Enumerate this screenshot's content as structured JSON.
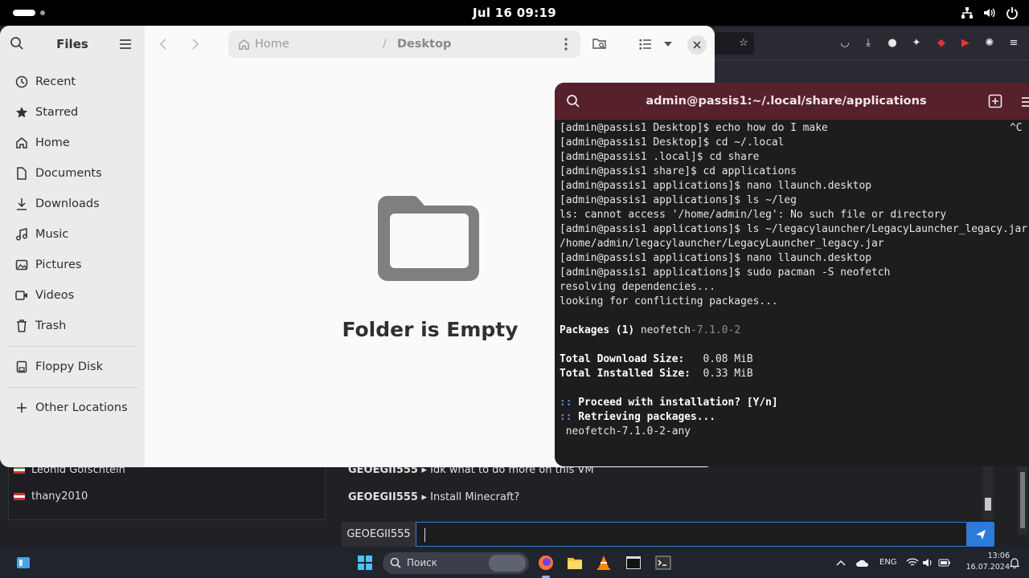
{
  "topbar": {
    "datetime": "Jul 16  09:19"
  },
  "files": {
    "sidebar_title": "Files",
    "places": [
      {
        "label": "Recent",
        "icon": "clock-icon"
      },
      {
        "label": "Starred",
        "icon": "star-icon"
      },
      {
        "label": "Home",
        "icon": "home-icon"
      },
      {
        "label": "Documents",
        "icon": "document-icon"
      },
      {
        "label": "Downloads",
        "icon": "download-icon"
      },
      {
        "label": "Music",
        "icon": "music-icon"
      },
      {
        "label": "Pictures",
        "icon": "picture-icon"
      },
      {
        "label": "Videos",
        "icon": "video-icon"
      },
      {
        "label": "Trash",
        "icon": "trash-icon"
      }
    ],
    "devices": [
      {
        "label": "Floppy Disk",
        "icon": "floppy-disk-icon"
      }
    ],
    "other": {
      "label": "Other Locations",
      "icon": "plus-icon"
    },
    "path": {
      "home": "Home",
      "separator": "/",
      "current": "Desktop"
    },
    "empty_message": "Folder is Empty"
  },
  "terminal": {
    "title": "admin@passis1:~/.local/share/applications",
    "ctrl_hint": "^C",
    "lines": [
      {
        "text": "[admin@passis1 Desktop]$ echo how do I make",
        "style": ""
      },
      {
        "text": "[admin@passis1 Desktop]$ cd ~/.local",
        "style": ""
      },
      {
        "text": "[admin@passis1 .local]$ cd share",
        "style": ""
      },
      {
        "text": "[admin@passis1 share]$ cd applications",
        "style": ""
      },
      {
        "text": "[admin@passis1 applications]$ nano llaunch.desktop",
        "style": ""
      },
      {
        "text": "[admin@passis1 applications]$ ls ~/leg",
        "style": ""
      },
      {
        "text": "ls: cannot access '/home/admin/leg': No such file or directory",
        "style": ""
      },
      {
        "text": "[admin@passis1 applications]$ ls ~/legacylauncher/LegacyLauncher_legacy.jar",
        "style": ""
      },
      {
        "text": "/home/admin/legacylauncher/LegacyLauncher_legacy.jar",
        "style": ""
      },
      {
        "text": "[admin@passis1 applications]$ nano llaunch.desktop",
        "style": ""
      },
      {
        "text": "[admin@passis1 applications]$ sudo pacman -S neofetch",
        "style": ""
      },
      {
        "text": "resolving dependencies...",
        "style": ""
      },
      {
        "text": "looking for conflicting packages...",
        "style": ""
      },
      {
        "text": "",
        "style": ""
      },
      {
        "text": "Packages (1) ",
        "style": "b",
        "extra": "neofetch",
        "extra_gray": "-7.1.0-2"
      },
      {
        "text": "",
        "style": ""
      },
      {
        "text": "Total Download Size:  ",
        "style": "b",
        "extra": " 0.08 MiB"
      },
      {
        "text": "Total Installed Size: ",
        "style": "b",
        "extra": " 0.33 MiB"
      },
      {
        "text": "",
        "style": ""
      },
      {
        "text": ":: ",
        "style": "blue",
        "extra_bold": "Proceed with installation? [Y/n]"
      },
      {
        "text": ":: ",
        "style": "blue",
        "extra_bold": "Retrieving packages..."
      },
      {
        "text": " neofetch-7.1.0-2-any",
        "style": ""
      }
    ]
  },
  "background": {
    "chat_users": [
      "Leonid Gofschtein",
      "thany2010"
    ],
    "messages": [
      {
        "author": "GEOEGII555 ▸",
        "text": "Idk what to do more on this VM"
      },
      {
        "author": "GEOEGII555 ▸",
        "text": "Install Minecraft?"
      }
    ],
    "chat_name": "GEOEGII555",
    "chat_input_value": ""
  },
  "taskbar": {
    "search_placeholder": "Поиск",
    "language": "ENG",
    "time": "13:06",
    "date": "16.07.2024"
  }
}
